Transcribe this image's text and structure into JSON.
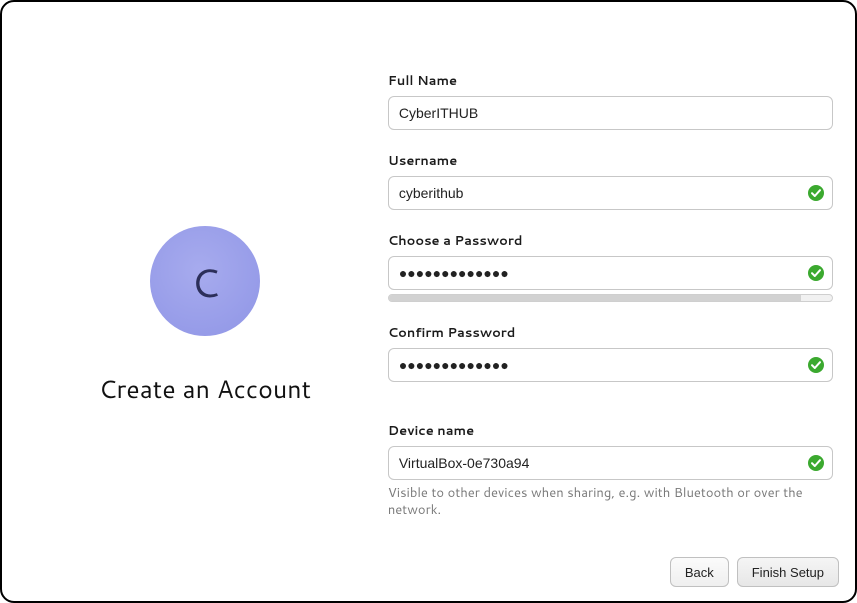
{
  "heading": "Create an Account",
  "avatar_letter": "C",
  "fields": {
    "fullname": {
      "label": "Full Name",
      "value": "CyberITHUB",
      "valid": false
    },
    "username": {
      "label": "Username",
      "value": "cyberithub",
      "valid": true
    },
    "password": {
      "label": "Choose a Password",
      "value": "●●●●●●●●●●●●●",
      "valid": true
    },
    "confirm": {
      "label": "Confirm Password",
      "value": "●●●●●●●●●●●●●",
      "valid": true
    },
    "device": {
      "label": "Device name",
      "value": "VirtualBox-0e730a94",
      "valid": true,
      "hint": "Visible to other devices when sharing, e.g. with Bluetooth or over the network."
    }
  },
  "buttons": {
    "back": "Back",
    "finish": "Finish Setup"
  }
}
